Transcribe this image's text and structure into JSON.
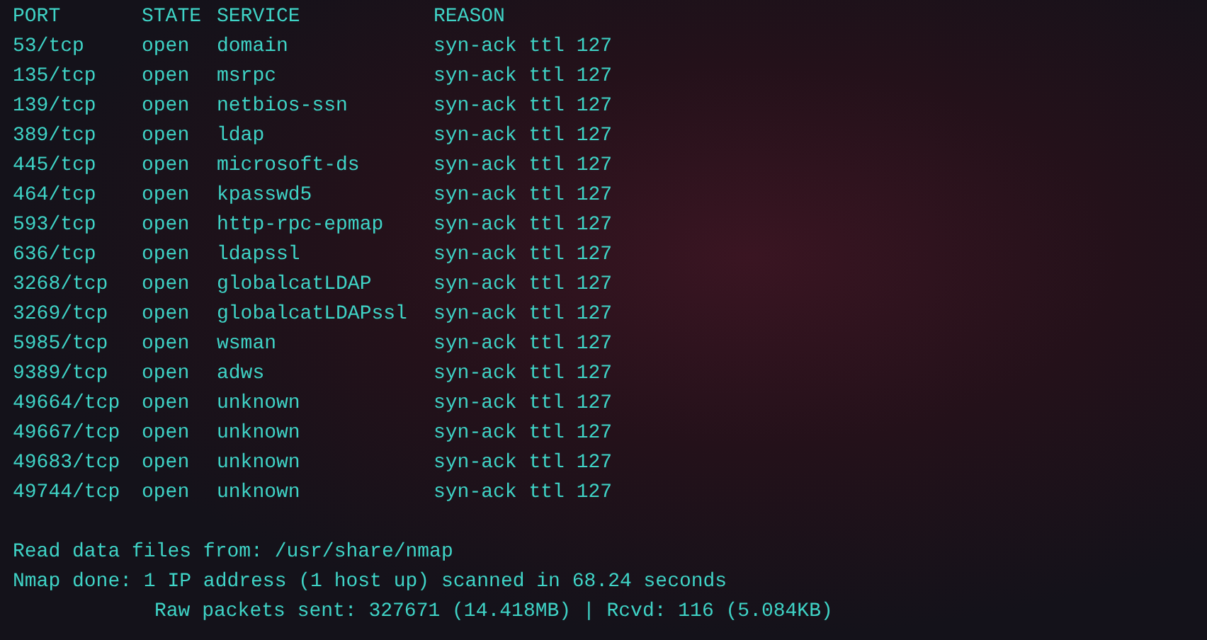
{
  "table": {
    "columns": [
      "PORT",
      "STATE",
      "SERVICE",
      "REASON"
    ],
    "rows": [
      {
        "port": "53/tcp",
        "state": "open",
        "service": "domain",
        "reason": "syn-ack ttl 127"
      },
      {
        "port": "135/tcp",
        "state": "open",
        "service": "msrpc",
        "reason": "syn-ack ttl 127"
      },
      {
        "port": "139/tcp",
        "state": "open",
        "service": "netbios-ssn",
        "reason": "syn-ack ttl 127"
      },
      {
        "port": "389/tcp",
        "state": "open",
        "service": "ldap",
        "reason": "syn-ack ttl 127"
      },
      {
        "port": "445/tcp",
        "state": "open",
        "service": "microsoft-ds",
        "reason": "syn-ack ttl 127"
      },
      {
        "port": "464/tcp",
        "state": "open",
        "service": "kpasswd5",
        "reason": "syn-ack ttl 127"
      },
      {
        "port": "593/tcp",
        "state": "open",
        "service": "http-rpc-epmap",
        "reason": "syn-ack ttl 127"
      },
      {
        "port": "636/tcp",
        "state": "open",
        "service": "ldapssl",
        "reason": "syn-ack ttl 127"
      },
      {
        "port": "3268/tcp",
        "state": "open",
        "service": "globalcatLDAP",
        "reason": "syn-ack ttl 127"
      },
      {
        "port": "3269/tcp",
        "state": "open",
        "service": "globalcatLDAPssl",
        "reason": "syn-ack ttl 127"
      },
      {
        "port": "5985/tcp",
        "state": "open",
        "service": "wsman",
        "reason": "syn-ack ttl 127"
      },
      {
        "port": "9389/tcp",
        "state": "open",
        "service": "adws",
        "reason": "syn-ack ttl 127"
      },
      {
        "port": "49664/tcp",
        "state": "open",
        "service": "unknown",
        "reason": "syn-ack ttl 127"
      },
      {
        "port": "49667/tcp",
        "state": "open",
        "service": "unknown",
        "reason": "syn-ack ttl 127"
      },
      {
        "port": "49683/tcp",
        "state": "open",
        "service": "unknown",
        "reason": "syn-ack ttl 127"
      },
      {
        "port": "49744/tcp",
        "state": "open",
        "service": "unknown",
        "reason": "syn-ack ttl 127"
      }
    ]
  },
  "footer": [
    {
      "kind": "plain",
      "text": "Read data files from: /usr/share/nmap"
    },
    {
      "kind": "plain",
      "text": "Nmap done: 1 IP address (1 host up) scanned in 68.24 seconds"
    },
    {
      "kind": "indented",
      "text": "Raw packets sent: 327671 (14.418MB) | Rcvd: 116 (5.084KB)"
    }
  ]
}
